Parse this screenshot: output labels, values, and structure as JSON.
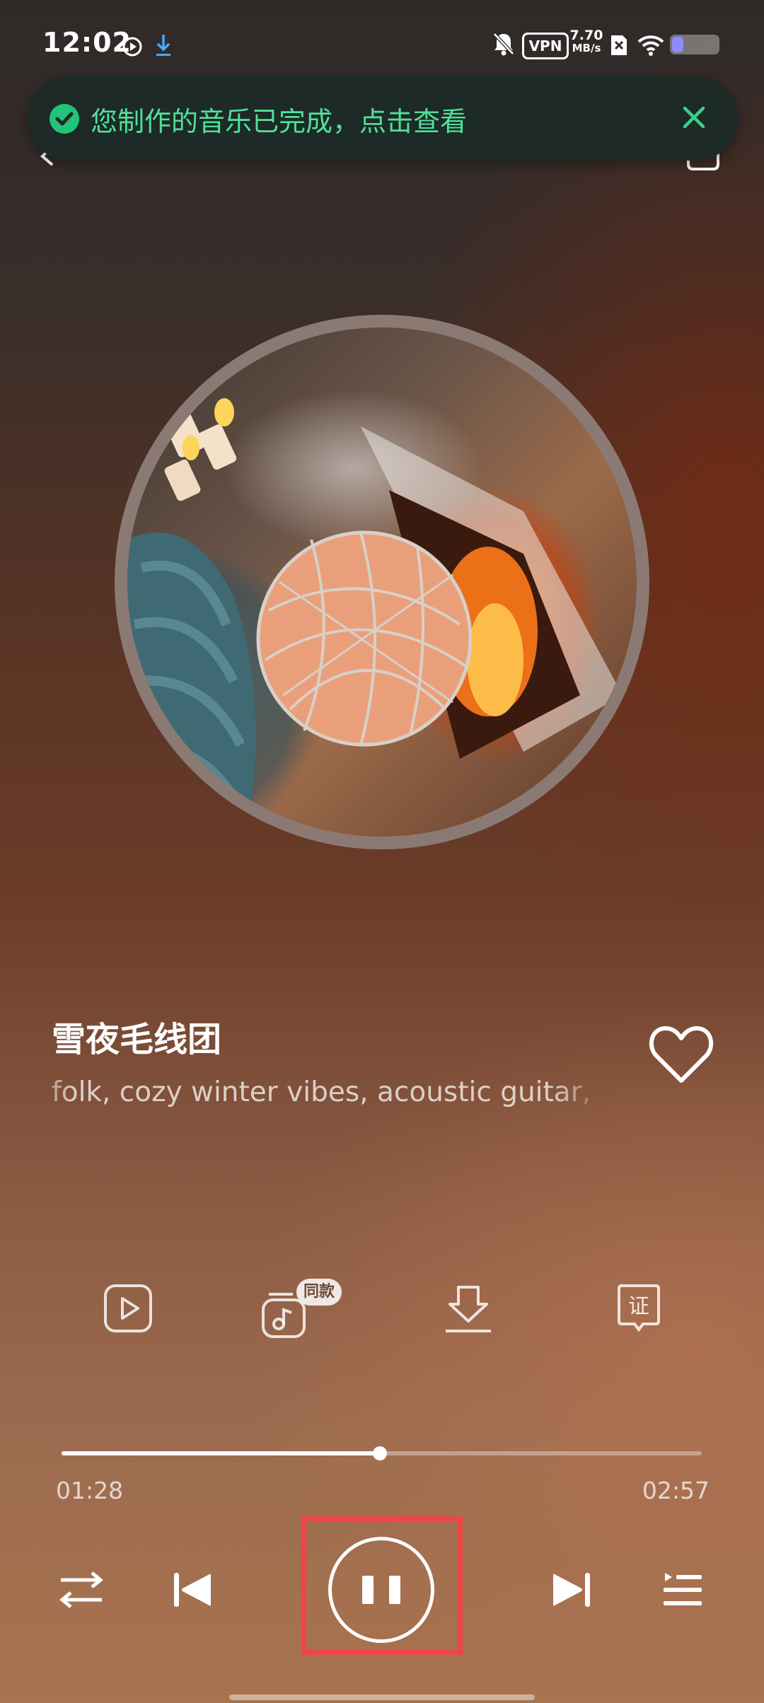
{
  "status_bar": {
    "time": "12:02",
    "vpn_label": "VPN",
    "net_speed_value": "7.70",
    "net_speed_unit": "MB/s",
    "battery_level": 0.25,
    "icons": [
      "play-circle-icon",
      "download-icon",
      "bell-off-icon",
      "vpn-icon",
      "sim-off-icon",
      "wifi-icon",
      "battery-icon"
    ]
  },
  "toast": {
    "message": "您制作的音乐已完成，点击查看",
    "icons": [
      "check-circle-icon",
      "close-icon"
    ],
    "accent": "#21c47a"
  },
  "song": {
    "title": "雪夜毛线团",
    "tags": "folk, cozy winter vibes, acoustic guitar, s"
  },
  "actions": [
    {
      "name": "video",
      "icon": "video-play-icon"
    },
    {
      "name": "same-style",
      "icon": "music-note-icon",
      "badge": "同款"
    },
    {
      "name": "download",
      "icon": "download-icon"
    },
    {
      "name": "certificate",
      "icon": "certificate-icon",
      "label": "证"
    }
  ],
  "player": {
    "current_time": "01:28",
    "total_time": "02:57",
    "progress": 0.497,
    "state": "playing",
    "controls": [
      "shuffle-icon",
      "previous-icon",
      "pause-icon",
      "next-icon",
      "playlist-icon"
    ],
    "highlight_color": "#ef4545"
  }
}
